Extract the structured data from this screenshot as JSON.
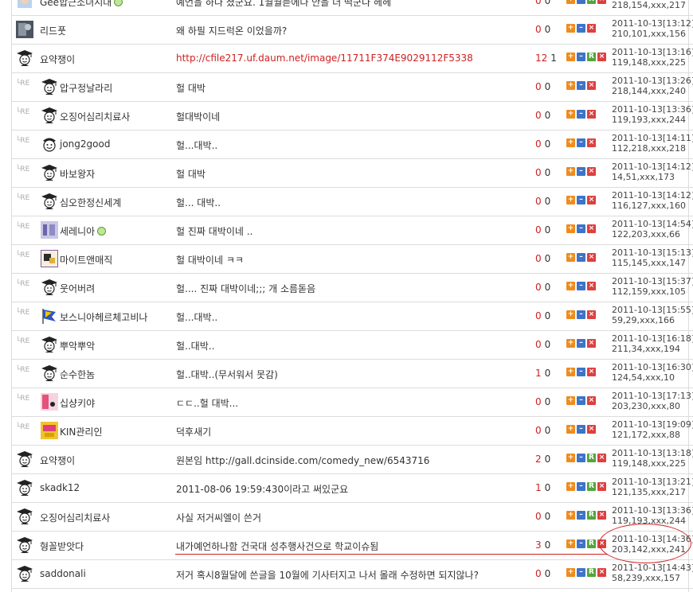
{
  "buttons": {
    "plus": "+",
    "minus": "–",
    "report": "R",
    "delete": "×"
  },
  "reply_marker": "└RE",
  "rows": [
    {
      "kind": "top",
      "icon": "avatar-face-icon",
      "nick": "Gee합근소녀시대",
      "online": true,
      "comment": "예언을 하다 쳤군요. 1월월듣에다 안을 더 떡군다 헤헤",
      "link": false,
      "up": "0",
      "down": "0",
      "time": "",
      "ip": "218,154,xxx,217",
      "has_r": true
    },
    {
      "kind": "top",
      "icon": "avatar-photo-icon",
      "nick": "리드풋",
      "online": false,
      "comment": "왜 하필 지드럭온 이었을까?",
      "link": false,
      "up": "0",
      "down": "0",
      "time": "2011-10-13[13:12]",
      "ip": "210,101,xxx,156",
      "has_r": false
    },
    {
      "kind": "top",
      "icon": "gallery-student-icon",
      "nick": "요약쟁이",
      "online": false,
      "comment": "http://cfile217.uf.daum.net/image/11711F374E9029112F5338",
      "link": true,
      "up": "12",
      "down": "1",
      "time": "2011-10-13[13:16]",
      "ip": "119,148,xxx,225",
      "has_r": true
    },
    {
      "kind": "reply",
      "icon": "gallery-student-icon",
      "nick": "압구정날라리",
      "online": false,
      "comment": "헐 대박",
      "link": false,
      "up": "0",
      "down": "0",
      "time": "2011-10-13[13:26]",
      "ip": "218,144,xxx,240",
      "has_r": false
    },
    {
      "kind": "reply",
      "icon": "gallery-student-icon",
      "nick": "오징어심리치료사",
      "online": false,
      "comment": "헐대박이네",
      "link": false,
      "up": "0",
      "down": "0",
      "time": "2011-10-13[13:36]",
      "ip": "119,193,xxx,244",
      "has_r": false
    },
    {
      "kind": "reply",
      "icon": "gallery-smile-icon",
      "nick": "jong2good",
      "online": false,
      "comment": "헐...대박..",
      "link": false,
      "up": "0",
      "down": "0",
      "time": "2011-10-13[14:11]",
      "ip": "112,218,xxx,218",
      "has_r": false
    },
    {
      "kind": "reply",
      "icon": "gallery-student-icon",
      "nick": "바보왕자",
      "online": false,
      "comment": "헐 대박",
      "link": false,
      "up": "0",
      "down": "0",
      "time": "2011-10-13[14:12]",
      "ip": "14,51,xxx,173",
      "has_r": false
    },
    {
      "kind": "reply",
      "icon": "gallery-student-icon",
      "nick": "심오한정신세계",
      "online": false,
      "comment": "헐... 대박..",
      "link": false,
      "up": "0",
      "down": "0",
      "time": "2011-10-13[14:12]",
      "ip": "116,127,xxx,160",
      "has_r": false
    },
    {
      "kind": "reply",
      "icon": "avatar-anime-icon",
      "nick": "세레니아",
      "online": true,
      "comment": "헐 진짜 대박이네 ..",
      "link": false,
      "up": "0",
      "down": "0",
      "time": "2011-10-13[14:54]",
      "ip": "122,203,xxx,66",
      "has_r": false
    },
    {
      "kind": "reply",
      "icon": "avatar-pixel-icon",
      "nick": "마이트앤매직",
      "online": false,
      "comment": "헐 대박이네 ㅋㅋ",
      "link": false,
      "up": "0",
      "down": "0",
      "time": "2011-10-13[15:13]",
      "ip": "115,145,xxx,147",
      "has_r": false
    },
    {
      "kind": "reply",
      "icon": "gallery-student-icon",
      "nick": "웃어버려",
      "online": false,
      "comment": "헐.... 진짜 대박이네;;; 개 소름돋음",
      "link": false,
      "up": "0",
      "down": "0",
      "time": "2011-10-13[15:37]",
      "ip": "112,159,xxx,105",
      "has_r": false
    },
    {
      "kind": "reply",
      "icon": "avatar-flag-icon",
      "nick": "보스니아헤르체고비나",
      "online": false,
      "comment": "헐...대박..",
      "link": false,
      "up": "0",
      "down": "0",
      "time": "2011-10-13[15:55]",
      "ip": "59,29,xxx,166",
      "has_r": false
    },
    {
      "kind": "reply",
      "icon": "gallery-student-icon",
      "nick": "뿌악뿌악",
      "online": false,
      "comment": "헐..대박..",
      "link": false,
      "up": "0",
      "down": "0",
      "time": "2011-10-13[16:18]",
      "ip": "211,34,xxx,194",
      "has_r": false
    },
    {
      "kind": "reply",
      "icon": "gallery-student-icon",
      "nick": "순수한놈",
      "online": false,
      "comment": "헐..대박..(무서워서 못감)",
      "link": false,
      "up": "1",
      "down": "0",
      "time": "2011-10-13[16:30]",
      "ip": "124,54,xxx,10",
      "has_r": false
    },
    {
      "kind": "reply",
      "icon": "avatar-pink-icon",
      "nick": "십샹키야",
      "online": false,
      "comment": "ㄷㄷ..헐 대박...",
      "link": false,
      "up": "0",
      "down": "0",
      "time": "2011-10-13[17:13]",
      "ip": "203,230,xxx,80",
      "has_r": false
    },
    {
      "kind": "reply",
      "icon": "avatar-kin-icon",
      "nick": "KIN관리인",
      "online": false,
      "comment": "덕후새기",
      "link": false,
      "up": "0",
      "down": "0",
      "time": "2011-10-13[19:09]",
      "ip": "121,172,xxx,88",
      "has_r": false
    },
    {
      "kind": "top",
      "icon": "gallery-student-icon",
      "nick": "요약쟁이",
      "online": false,
      "comment": "원본임 http://gall.dcinside.com/comedy_new/6543716",
      "link": false,
      "up": "2",
      "down": "0",
      "time": "2011-10-13[13:18]",
      "ip": "119,148,xxx,225",
      "has_r": true
    },
    {
      "kind": "top",
      "icon": "gallery-student-icon",
      "nick": "skadk12",
      "online": false,
      "comment": "2011-08-06 19:59:430이라고 써있군요",
      "link": false,
      "up": "1",
      "down": "0",
      "time": "2011-10-13[13:21]",
      "ip": "121,135,xxx,217",
      "has_r": true
    },
    {
      "kind": "top",
      "icon": "gallery-student-icon",
      "nick": "오징어심리치료사",
      "online": false,
      "comment": "사실 저거씨엘이 쓴거",
      "link": false,
      "up": "0",
      "down": "0",
      "time": "2011-10-13[13:36]",
      "ip": "119,193,xxx,244",
      "has_r": true
    },
    {
      "kind": "top",
      "icon": "gallery-student-icon",
      "nick": "형꼴받앗다",
      "online": false,
      "comment": "내가예언하나함 건국대 성추행사건으로 학교이슈됨",
      "link": false,
      "up": "3",
      "down": "0",
      "time": "2011-10-13[14:36]",
      "ip": "203,142,xxx,241",
      "has_r": true
    },
    {
      "kind": "top",
      "icon": "gallery-student-icon",
      "nick": "saddonali",
      "online": false,
      "comment": "저거 혹시8월달에 쓴글을 10월에 기사터지고 나서 몰래 수정하면 되지않나?",
      "link": false,
      "up": "0",
      "down": "0",
      "time": "2011-10-13[14:43]",
      "ip": "58,239,xxx,157",
      "has_r": true
    }
  ]
}
